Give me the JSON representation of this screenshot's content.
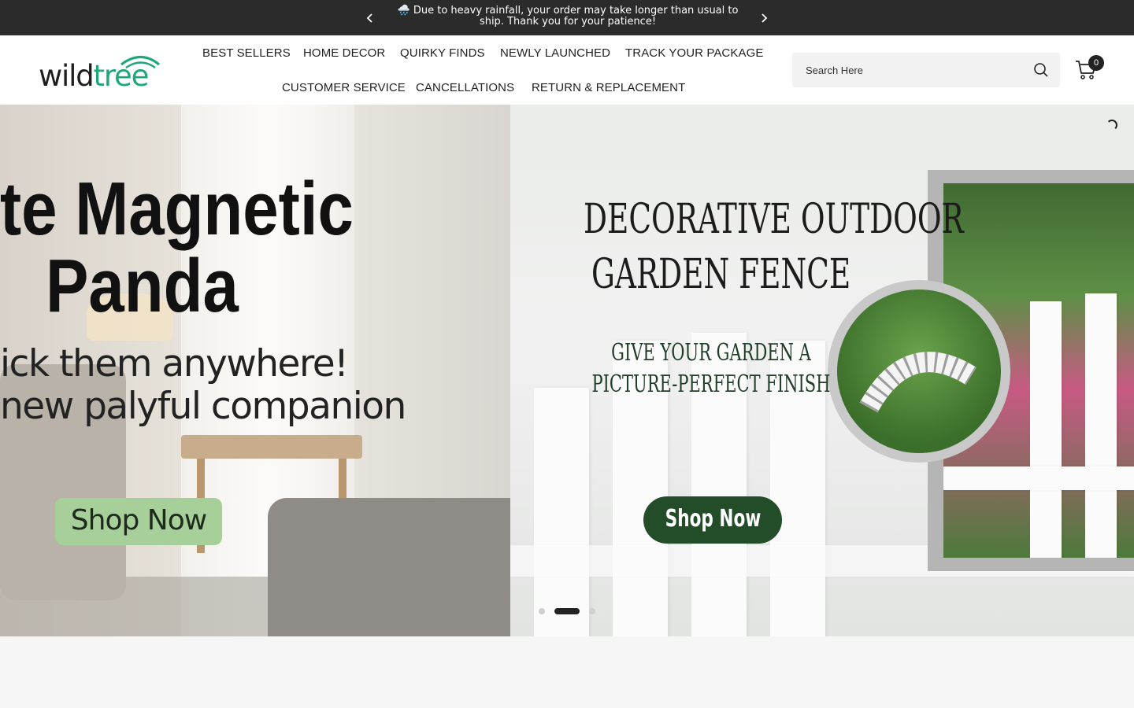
{
  "announcement": {
    "icon": "rain-cloud-icon",
    "text": "🌧️ Due to heavy rainfall, your order may take longer than usual to ship. Thank you for your patience!"
  },
  "header": {
    "logo_text": "wildtree",
    "nav_row1": [
      "BEST SELLERS",
      "HOME DECOR",
      "QUIRKY FINDS",
      "NEWLY LAUNCHED",
      "TRACK YOUR PACKAGE"
    ],
    "nav_row2": [
      "CUSTOMER SERVICE",
      "CANCELLATIONS",
      "RETURN & REPLACEMENT"
    ],
    "search": {
      "placeholder": "Search Here"
    },
    "cart": {
      "count": "0"
    }
  },
  "hero": {
    "slide_left": {
      "headline_1": "te Magnetic",
      "headline_2": "Panda",
      "line_1": "ick them anywhere!",
      "line_2": "new palyful companion",
      "button": "Shop Now"
    },
    "slide_right": {
      "title_1": "DECORATIVE OUTDOOR",
      "title_2": "GARDEN FENCE",
      "subtitle_1": "GIVE YOUR GARDEN A",
      "subtitle_2": "PICTURE-PERFECT FINISH",
      "button": "Shop Now"
    },
    "dots": {
      "count": 3,
      "active_index": 1
    }
  },
  "colors": {
    "announcement_bg": "#2b2b2b",
    "accent_green": "#1fa67a",
    "button_left": "#a6cf9a",
    "button_right": "#234d29"
  }
}
